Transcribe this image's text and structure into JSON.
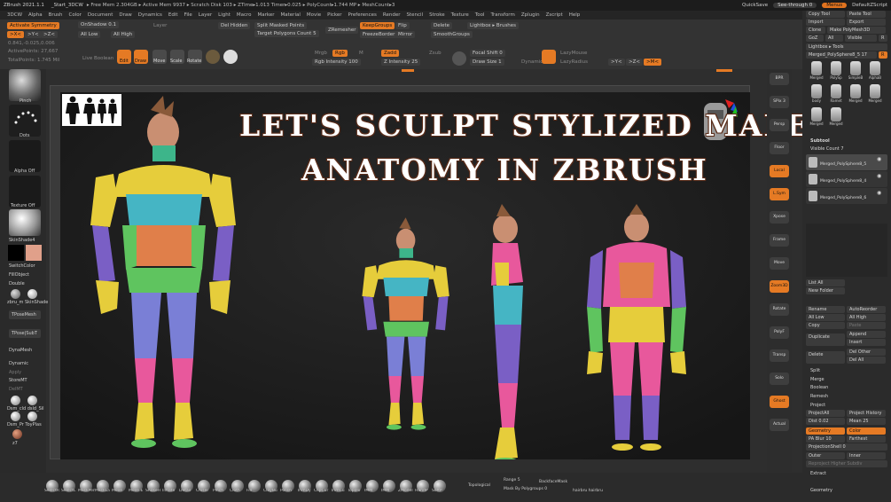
{
  "titlebar": {
    "app": "ZBrush 2021.1.1",
    "file": "_Start_3DCW",
    "stats": "▸ Free Mem 2.304GB ▸ Active Mem 9937 ▸ Scratch Disk 103 ▸ ZTime▸1.013 Timer▸0.025 ▸ PolyCount▸1.744 MP ▸ MeshCount▸3",
    "quicksave": "QuickSave",
    "seethrough": "See-through  0",
    "menus": "Menus",
    "script": "DefaultZScript"
  },
  "menubar": [
    "3DCW",
    "Alpha",
    "Brush",
    "Color",
    "Document",
    "Draw",
    "Dynamics",
    "Edit",
    "File",
    "Layer",
    "Light",
    "Macro",
    "Marker",
    "Material",
    "Movie",
    "Picker",
    "Preferences",
    "Render",
    "Stencil",
    "Stroke",
    "Texture",
    "Tool",
    "Transform",
    "Zplugin",
    "Zscript",
    "Help"
  ],
  "top": {
    "activate_symmetry": "Activate Symmetry",
    "x": ">X<",
    "y": ">Y<",
    "z": ">Z<",
    "on_shadow": "OnShadow 0.1",
    "all_low": "All Low",
    "all_high": "All High",
    "layer": "Layer",
    "del_hidden": "Del Hidden",
    "split_masked": "Split Masked Points",
    "target_poly": "Target Polygons Count 5",
    "zremesher": "ZRemesher",
    "keepgroups": "KeepGroups",
    "flip": "Flip",
    "freezeborder": "FreezeBorder",
    "mirror": "Mirror",
    "delete": "Delete",
    "smoothgroups": "SmoothGroups",
    "lightbox": "Lightbox ▸ Brushes",
    "focal_shift": "Focal Shift 0",
    "draw_size": "Draw Size 1",
    "dynamic": "Dynamic",
    "lazymouse": "LazyMouse",
    "lazyradius": "LazyRadius",
    "live_boolean": "Live Boolean",
    "edit": "Edit",
    "draw": "Draw",
    "move": "Move",
    "scale": "Scale",
    "rotate": "Rotate",
    "mrgb": "Mrgb",
    "rgb": "Rgb",
    "m": "M",
    "zadd": "Zadd",
    "zsub": "Zsub",
    "rgb_intensity": "Rgb Intensity 100",
    "z_intensity": "Z Intensity 25",
    "active_points": "ActivePoints: 27,667",
    "total_points": "TotalPoints: 1.745 Mil",
    "coords": "0.841,-0.025,0.006",
    "ax_y": ">Y<",
    "ax_z": ">Z<",
    "ax_m": ">M<"
  },
  "left": {
    "pinch": "Pinch",
    "dots": "Dots",
    "alpha_off": "Alpha Off",
    "texture_off": "Texture Off",
    "skinshade": "SkinShade4",
    "switchcolor": "SwitchColor",
    "fillobject": "FillObject",
    "double": "Double",
    "zbru": "zbru_m  SkinShade",
    "tposemesh": "TPoseMesh",
    "tposesubt": "TPose|SubT",
    "dynamesh": "DynaMesh",
    "dynamic": "Dynamic",
    "apply": "Apply",
    "storemt": "StoreMT",
    "delmt": "DelMT",
    "dsm": "Dsm_cld  dsld_Sil",
    "dsm2": "Dsm_Pr  ToyPlas",
    "z7": "z7"
  },
  "headline": {
    "line1": "LET'S SCULPT STYLIZED MALE",
    "line2": "ANATOMY IN ZBRUSH"
  },
  "rightshelf": [
    "BPR",
    "SPix 3",
    "Persp",
    "Floor",
    "Local",
    "L.Sym",
    "Xpose",
    "Frame",
    "Move",
    "Zoom3D",
    "Rotate",
    "PolyF",
    "Transp",
    "Solo",
    "Ghost",
    "Actual"
  ],
  "rightpanel": {
    "copy_tool": "Copy Tool",
    "paste_tool": "Paste Tool",
    "import": "Import",
    "export": "Export",
    "clone": "Clone",
    "make_polymesh": "Make PolyMesh3D",
    "goz": "GoZ",
    "all": "All",
    "visible": "Visible",
    "r": "R",
    "lightbox_tools": "Lightbox ▸ Tools",
    "merged_name": "Merged_PolySphere8_5  17",
    "r2": "R",
    "thumbs": [
      "Merged",
      "PolySp",
      "SimpleB",
      "AlphaB",
      "body",
      "Ramet",
      "Merged",
      "Merged",
      "Merged",
      "Merged"
    ],
    "subtool": "Subtool",
    "visible_count": "Visible Count 7",
    "subtools": [
      "Merged_PolySphere8_5",
      "Merged_PolySphere8_4",
      "Merged_PolySphere8_6"
    ],
    "list_all": "List All",
    "new_folder": "New Folder",
    "rename": "Rename",
    "autoreorder": "AutoReorder",
    "all_low": "All Low",
    "all_high": "All High",
    "copy": "Copy",
    "paste": "Paste",
    "duplicate": "Duplicate",
    "append": "Append",
    "insert": "Insert",
    "delete": "Delete",
    "del_other": "Del Other",
    "del_all": "Del All",
    "split": "Split",
    "merge": "Merge",
    "boolean": "Boolean",
    "remesh": "Remesh",
    "project": "Project",
    "projectall": "ProjectAll",
    "project_history": "Project History",
    "dist": "Dist 0.02",
    "mean": "Mean 25",
    "geometry": "Geometry",
    "color": "Color",
    "pa_blur": "PA Blur 10",
    "farthest": "Farthest",
    "projection_shell": "ProjectionShell 0",
    "outer": "Outer",
    "inner": "Inner",
    "reproject": "Reproject Higher Subdiv",
    "extract": "Extract",
    "geometry2": "Geometry"
  },
  "bottom": {
    "brushes": [
      "SelectR",
      "SelectL",
      "MaskPen",
      "MaskLa",
      "Move",
      "Move E",
      "SnakeH",
      "Inflate",
      "Detail",
      "Chisel",
      "Pinch",
      "Cloth",
      "Fill",
      "ClayBu",
      "Polish",
      "TrimDy",
      "ClipCur",
      "TrimCu",
      "Topolo",
      "IMM",
      "IMM",
      "ZModel",
      "HandP",
      "SoftP"
    ],
    "topological": "Topological",
    "range": "Range 5",
    "backfacemask": "BackfaceMask",
    "mask_by_polygroups": "Mask By Polygroups 0",
    "hairbrush": "hairbru  hairbru"
  }
}
